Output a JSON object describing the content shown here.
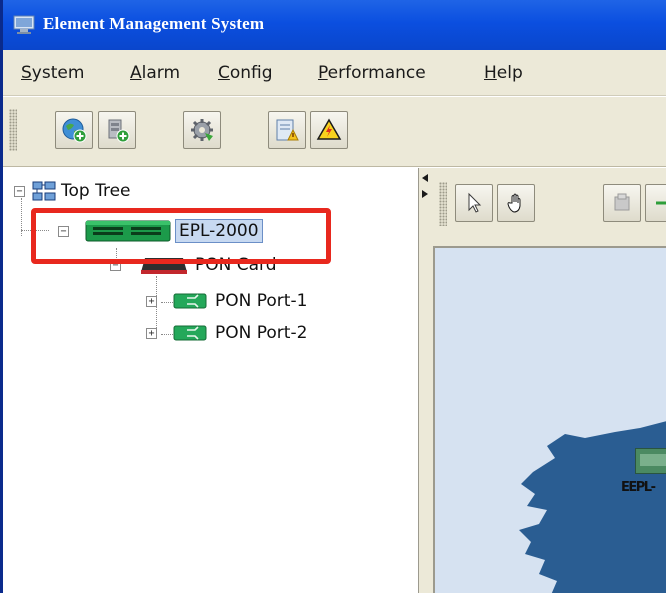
{
  "window": {
    "title": "Element Management System",
    "title_bar_color": "#0b4fe0"
  },
  "menu": {
    "items": [
      {
        "mnemonic": "S",
        "rest": "ystem"
      },
      {
        "mnemonic": "A",
        "rest": "larm"
      },
      {
        "mnemonic": "C",
        "rest": "onfig"
      },
      {
        "mnemonic": "P",
        "rest": "erformance"
      },
      {
        "mnemonic": "H",
        "rest": "elp"
      }
    ]
  },
  "toolbar": {
    "buttons": [
      {
        "icon": "globe-add-icon"
      },
      {
        "icon": "device-add-icon"
      },
      {
        "icon": "gear-icon"
      },
      {
        "icon": "alarm-report-icon"
      },
      {
        "icon": "warning-icon"
      }
    ]
  },
  "tree": {
    "root": {
      "label": "Top Tree",
      "icon": "network-tree-icon",
      "expanded": true
    },
    "device": {
      "label": "EPL-2000",
      "icon": "olt-device-icon",
      "expanded": true,
      "selected": true
    },
    "card": {
      "label": "PON Card",
      "icon": "pon-card-icon",
      "expanded": true
    },
    "ports": [
      {
        "label": "PON Port-1",
        "icon": "pon-port-icon",
        "expanded": false
      },
      {
        "label": "PON Port-2",
        "icon": "pon-port-icon",
        "expanded": false
      }
    ],
    "highlight_color": "#e8281e"
  },
  "map": {
    "tools": [
      {
        "icon": "pointer-icon"
      },
      {
        "icon": "hand-pan-icon"
      },
      {
        "icon": "device-icon"
      },
      {
        "icon": "connect-icon"
      }
    ],
    "background_color": "#d6e2f1",
    "land_color": "#2a5d92",
    "node_label": "EEPL-"
  }
}
